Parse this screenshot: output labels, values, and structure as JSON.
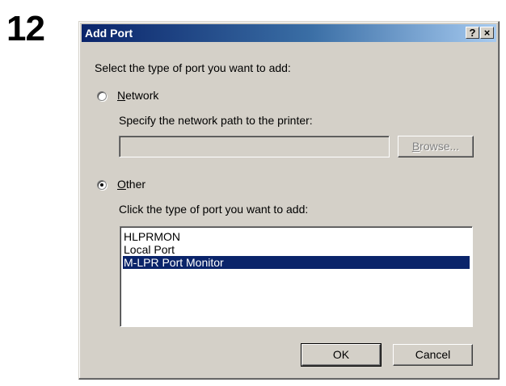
{
  "step_number": "12",
  "dialog": {
    "title": "Add Port",
    "help_button": "?",
    "close_button": "×",
    "prompt": "Select the type of port you want to add:",
    "network": {
      "label_hotkey": "N",
      "label_rest": "etwork",
      "selected": false,
      "description": "Specify the network path to the printer:",
      "path_value": "",
      "browse_hotkey": "B",
      "browse_rest": "rowse..."
    },
    "other": {
      "label_hotkey": "O",
      "label_rest": "ther",
      "selected": true,
      "description": "Click the type of port you want to add:",
      "port_types": [
        "HLPRMON",
        "Local Port",
        "M-LPR Port Monitor"
      ],
      "selected_port": "M-LPR Port Monitor"
    },
    "ok_label": "OK",
    "cancel_label": "Cancel"
  }
}
